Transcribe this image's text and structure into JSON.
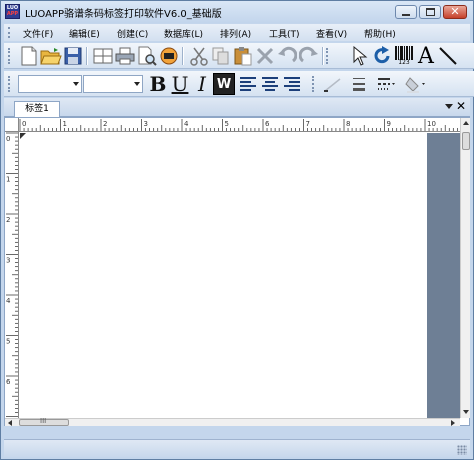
{
  "window": {
    "title": "LUOAPP骆谱条码标签打印软件V6.0_基础版",
    "app_icon_text": [
      "LUO",
      "APP"
    ],
    "close_glyph": "✕"
  },
  "menu": {
    "items": [
      {
        "label": "文件(F)"
      },
      {
        "label": "编辑(E)"
      },
      {
        "label": "创建(C)"
      },
      {
        "label": "数据库(L)"
      },
      {
        "label": "排列(A)"
      },
      {
        "label": "工具(T)"
      },
      {
        "label": "查看(V)"
      },
      {
        "label": "帮助(H)"
      }
    ]
  },
  "toolbar": {
    "barcode_caption": "123",
    "text_tool_glyph": "A",
    "bold_glyph": "B",
    "underline_glyph": "U",
    "italic_glyph": "I",
    "wrap_glyph": "W",
    "font_name_value": "",
    "font_size_value": ""
  },
  "document": {
    "tab_label": "标签1",
    "tab_close_glyph": "✕",
    "ruler_h_numbers": [
      "0",
      "1",
      "2",
      "3",
      "4",
      "5",
      "6",
      "7",
      "8",
      "9",
      "10"
    ],
    "ruler_v_numbers": [
      "0",
      "1",
      "2",
      "3",
      "4",
      "5",
      "6"
    ],
    "hscroll_thumb_glyph": "III"
  }
}
